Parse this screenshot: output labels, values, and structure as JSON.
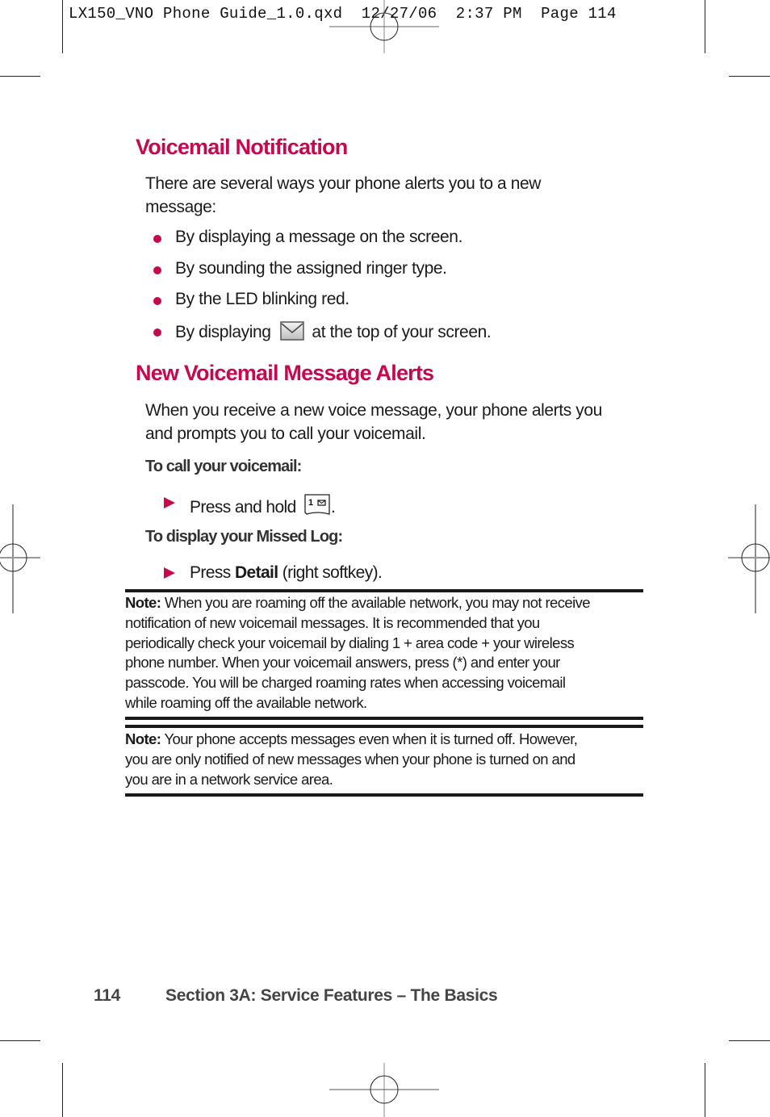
{
  "slug_line": "LX150_VNO Phone Guide_1.0.qxd  12/27/06  2:37 PM  Page 114",
  "colors": {
    "heading": "#c8084e",
    "bullet": "#c8084e",
    "text": "#1a1a1a",
    "subhead": "#333333",
    "footer": "#444444"
  },
  "section1": {
    "title": "Voicemail Notification",
    "intro_line1": "There are several ways your phone alerts you to a new",
    "intro_line2": "message:",
    "bullets": [
      "By displaying a message on the screen.",
      "By sounding the assigned ringer type.",
      "By the LED blinking red."
    ],
    "bullet4_before": "By displaying",
    "bullet4_icon": "envelope-icon",
    "bullet4_after": "at the top of your screen."
  },
  "section2": {
    "title": "New Voicemail Message Alerts",
    "intro_line1": "When you receive a new voice message, your phone alerts you",
    "intro_line2": "and prompts you to call your voicemail.",
    "subhead1": "To call your voicemail:",
    "step1_text": "Press and hold",
    "step1_key_icon": "key-1-voicemail-icon",
    "step1_end": ".",
    "subhead2": "To display your Missed Log:",
    "step2_before": "Press",
    "step2_bold": "Detail",
    "step2_after": "(right softkey)."
  },
  "notes": [
    {
      "label": "Note:",
      "lines": [
        "When you are roaming off the available network, you may not receive",
        "notification of new voicemail messages. It is recommended that you",
        "periodically check your voicemail by dialing 1 + area code + your wireless",
        "phone number. When your voicemail answers, press (*) and enter your",
        "passcode. You will be charged roaming rates when accessing voicemail",
        "while roaming off the available network."
      ]
    },
    {
      "label": "Note:",
      "lines": [
        "Your phone accepts messages even when it is turned off. However,",
        "you are only notified of new messages when your phone is turned on and",
        "you are in a network service area."
      ]
    }
  ],
  "footer": {
    "page_number": "114",
    "section_title": "Section 3A: Service Features – The Basics"
  }
}
